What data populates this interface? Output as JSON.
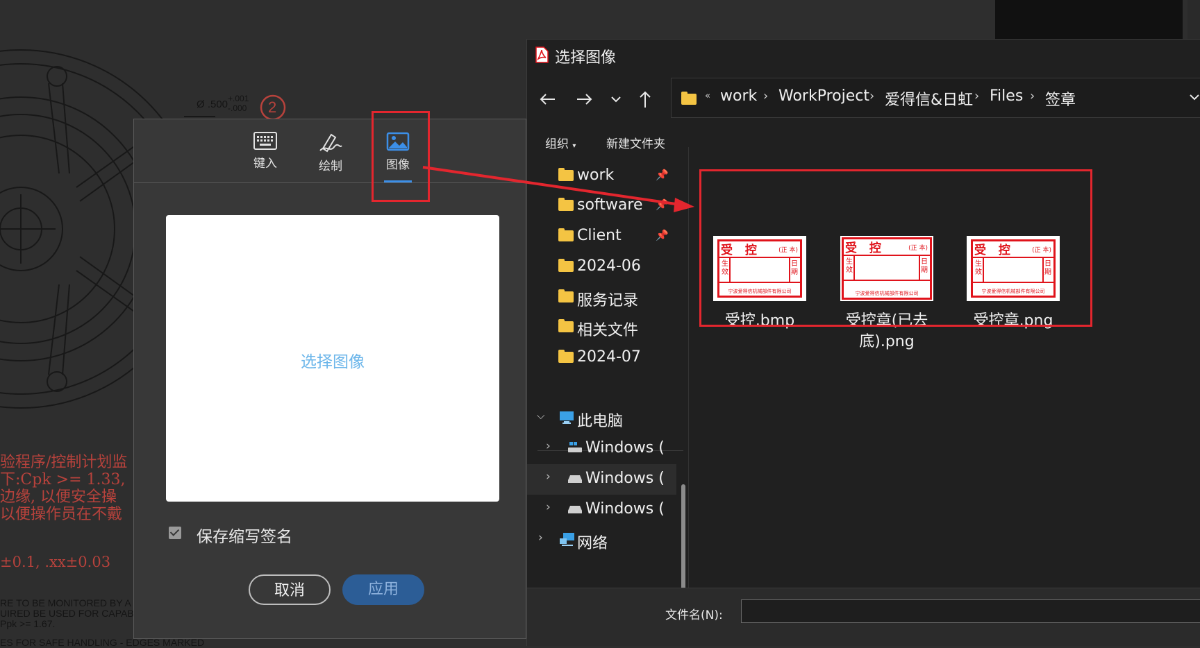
{
  "background_doc": {
    "dimension_text": "Ø .500",
    "tolerance_plus": "+.001",
    "tolerance_minus": "-.000",
    "balloon_number": "2",
    "red_lines": [
      "验程序/控制计划监",
      "下:Cpk >= 1.33,",
      "边缘, 以便安全操",
      "以便操作员在不戴"
    ],
    "red_tolerance": "±0.1, .xx±0.03",
    "black_lines": [
      "RE TO BE MONITORED BY A",
      "UIRED BE USED FOR CAPAB",
      "Ppk >= 1.67.",
      "ES FOR SAFE HANDLING - EDGES MARKED"
    ]
  },
  "signature_dialog": {
    "tabs": [
      {
        "label": "键入",
        "icon": "keyboard-icon"
      },
      {
        "label": "绘制",
        "icon": "pen-icon"
      },
      {
        "label": "图像",
        "icon": "image-icon",
        "selected": true
      }
    ],
    "drop_area_text": "选择图像",
    "save_checkbox_label": "保存缩写签名",
    "save_checked": true,
    "cancel_label": "取消",
    "apply_label": "应用"
  },
  "file_dialog": {
    "title": "选择图像",
    "breadcrumbs": [
      "work",
      "WorkProject",
      "爱得信&日虹",
      "Files",
      "签章"
    ],
    "toolbar": {
      "organize": "组织",
      "new_folder": "新建文件夹"
    },
    "nav_items": [
      {
        "label": "work",
        "type": "folder",
        "pinned": true
      },
      {
        "label": "software",
        "type": "folder",
        "pinned": true
      },
      {
        "label": "Client",
        "type": "folder",
        "pinned": true
      },
      {
        "label": "2024-06",
        "type": "folder"
      },
      {
        "label": "服务记录",
        "type": "folder"
      },
      {
        "label": "相关文件",
        "type": "folder"
      },
      {
        "label": "2024-07",
        "type": "folder"
      }
    ],
    "tree_items": [
      {
        "label": "此电脑",
        "icon": "computer-icon",
        "expanded": true
      },
      {
        "label": "Windows (",
        "icon": "drive-icon"
      },
      {
        "label": "Windows (",
        "icon": "drive-icon",
        "selected": true
      },
      {
        "label": "Windows (",
        "icon": "drive-icon"
      },
      {
        "label": "网络",
        "icon": "network-icon"
      }
    ],
    "files": [
      {
        "name": "受控.bmp"
      },
      {
        "name": "受控章(已去底).png"
      },
      {
        "name": "受控章.png"
      }
    ],
    "stamp": {
      "title": "受 控",
      "sub": "(正 本)",
      "left": "生效",
      "right": "日期",
      "bottom": "宁波爱得信机械部件有限公司"
    },
    "filename_label": "文件名(N):",
    "filename_value": ""
  },
  "colors": {
    "highlight": "#e3262e",
    "accent": "#3c8fe8"
  }
}
